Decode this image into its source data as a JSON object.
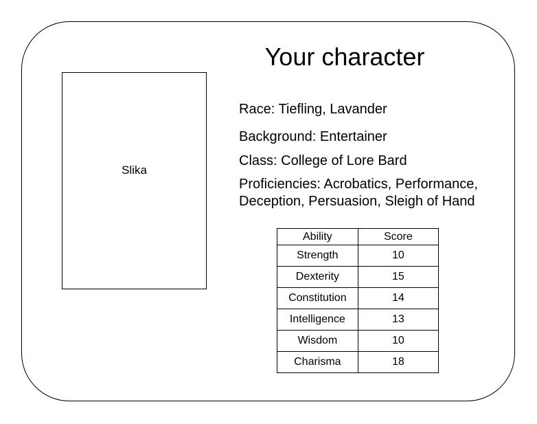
{
  "card": {
    "title": "Your character",
    "portrait_label": "Slika"
  },
  "info": {
    "race": "Race: Tiefling, Lavander",
    "background": "Background: Entertainer",
    "class": "Class: College of Lore Bard",
    "proficiencies_line1": "Proficiencies: Acrobatics, Performance,",
    "proficiencies_line2": "Deception, Persuasion, Sleigh of Hand"
  },
  "abilities": {
    "headers": [
      "Ability",
      "Score"
    ],
    "rows": [
      {
        "ability": "Strength",
        "score": "10"
      },
      {
        "ability": "Dexterity",
        "score": "15"
      },
      {
        "ability": "Constitution",
        "score": "14"
      },
      {
        "ability": "Intelligence",
        "score": "13"
      },
      {
        "ability": "Wisdom",
        "score": "10"
      },
      {
        "ability": "Charisma",
        "score": "18"
      }
    ]
  }
}
